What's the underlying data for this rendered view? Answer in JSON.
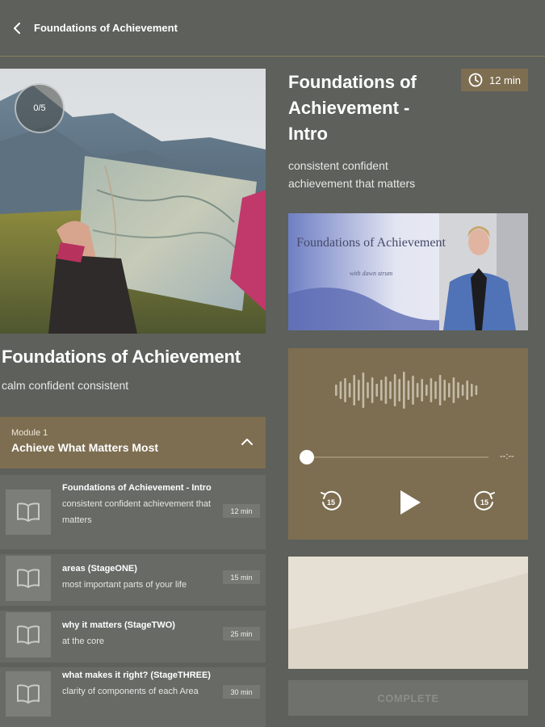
{
  "header": {
    "title": "Foundations of Achievement"
  },
  "hero": {
    "progress": "0/5"
  },
  "course": {
    "title": "Foundations of Achievement",
    "subtitle": "calm confident consistent"
  },
  "module": {
    "label": "Module 1",
    "title": "Achieve What Matters Most"
  },
  "lessons": [
    {
      "title": "Foundations of Achievement - Intro",
      "description": "consistent confident achievement that matters",
      "duration": "12 min"
    },
    {
      "title": "areas (StageONE)",
      "description": "most important parts of your life",
      "duration": "15 min"
    },
    {
      "title": "why it matters (StageTWO)",
      "description": "at the core",
      "duration": "25 min"
    },
    {
      "title": "what makes it right? (StageTHREE)",
      "description": "clarity of components of each Area",
      "duration": "30 min"
    }
  ],
  "current_lesson": {
    "title": "Foundations of Achievement - Intro",
    "duration": "12 min",
    "description": "consistent confident achievement that matters",
    "video_title": "Foundations of Achievement",
    "video_subtitle": "with dawn strum"
  },
  "player": {
    "time_remaining": "--:--",
    "rewind_seconds": "15",
    "forward_seconds": "15",
    "position_fraction": 0
  },
  "actions": {
    "complete_label": "COMPLETE"
  },
  "icons": {
    "back": "chevron-left-icon",
    "clock": "clock-icon",
    "book": "book-icon",
    "collapse": "chevron-up-icon",
    "play": "play-icon",
    "rewind": "rewind-15-icon",
    "forward": "forward-15-icon",
    "waveform": "waveform-icon"
  },
  "colors": {
    "background": "#5d605b",
    "accent": "#7d6e51",
    "lesson_row": "#676a65",
    "complete_disabled": "#6f716c"
  }
}
